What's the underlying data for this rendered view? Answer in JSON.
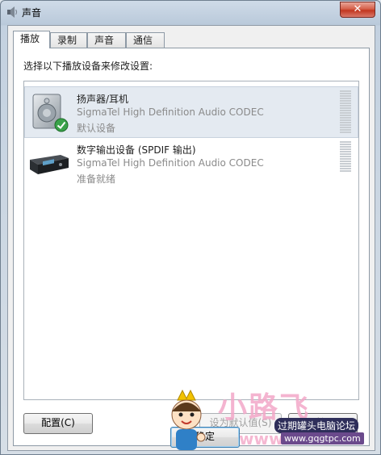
{
  "window": {
    "title": "声音",
    "close_glyph": "✕"
  },
  "tabs": [
    {
      "label": "播放",
      "active": true
    },
    {
      "label": "录制",
      "active": false
    },
    {
      "label": "声音",
      "active": false
    },
    {
      "label": "通信",
      "active": false
    }
  ],
  "panel": {
    "instruction": "选择以下播放设备来修改设置:"
  },
  "devices": [
    {
      "name": "扬声器/耳机",
      "description": "SigmaTel High Definition Audio CODEC",
      "status": "默认设备",
      "icon": "speaker-icon",
      "default_badge": "check-icon",
      "selected": true
    },
    {
      "name": "数字输出设备 (SPDIF 输出)",
      "description": "SigmaTel High Definition Audio CODEC",
      "status": "准备就绪",
      "icon": "digital-output-device-icon",
      "selected": false
    }
  ],
  "buttons": {
    "configure": "配置(C)",
    "set_default": "设为默认值(S)",
    "properties": "属性(P)",
    "ok": "确定"
  },
  "watermark": {
    "big_text": "小路飞",
    "forum": "过期罐头电脑论坛",
    "url": "www.gqgtpc.com",
    "www": "www"
  },
  "colors": {
    "selection": "#e4eaf1",
    "close_button": "#c2361f",
    "check_badge": "#3aa24a"
  }
}
